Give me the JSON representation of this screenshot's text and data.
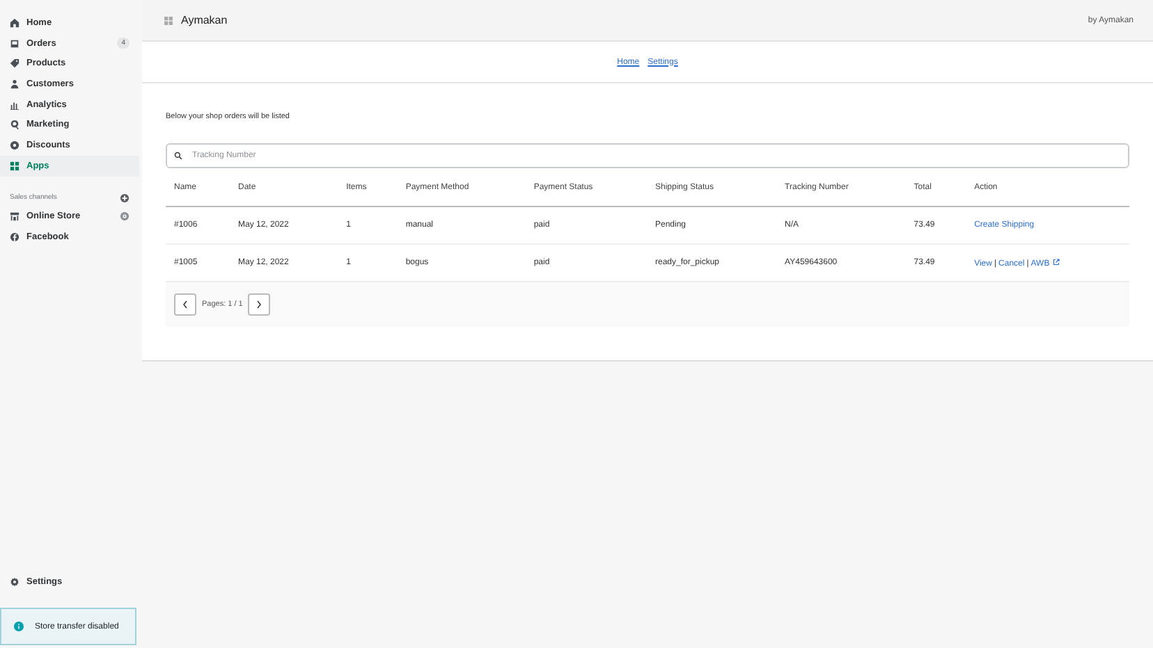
{
  "sidebar": {
    "items": [
      {
        "label": "Home",
        "selected": false
      },
      {
        "label": "Orders",
        "selected": false,
        "badge": "4"
      },
      {
        "label": "Products",
        "selected": false
      },
      {
        "label": "Customers",
        "selected": false
      },
      {
        "label": "Analytics",
        "selected": false
      },
      {
        "label": "Marketing",
        "selected": false
      },
      {
        "label": "Discounts",
        "selected": false
      },
      {
        "label": "Apps",
        "selected": true
      }
    ],
    "channels_heading": "Sales channels",
    "channels": [
      {
        "label": "Online Store",
        "eye": true
      },
      {
        "label": "Facebook",
        "eye": false
      }
    ],
    "settings": "Settings",
    "notice": "Store transfer disabled"
  },
  "header": {
    "title": "Aymakan",
    "byline": "by Aymakan"
  },
  "nav": [
    "Home",
    "Settings"
  ],
  "intro": "Below your shop orders will be listed",
  "search": {
    "placeholder": "Tracking Number"
  },
  "table": {
    "columns": [
      "Name",
      "Date",
      "Items",
      "Payment Method",
      "Payment Status",
      "Shipping Status",
      "Tracking Number",
      "Total",
      "Action"
    ],
    "rows": [
      {
        "cells": [
          "#1006",
          "May 12, 2022",
          "1",
          "manual",
          "paid",
          "Pending",
          "N/A",
          "73.49"
        ],
        "actions": [
          {
            "label": "Create Shipping",
            "external": false
          }
        ]
      },
      {
        "cells": [
          "#1005",
          "May 12, 2022",
          "1",
          "bogus",
          "paid",
          "ready_for_pickup",
          "AY459643600",
          "73.49"
        ],
        "separator": "|",
        "actions": [
          {
            "label": "View",
            "external": false
          },
          {
            "label": "Cancel",
            "external": false
          },
          {
            "label": "AWB",
            "external": true
          }
        ]
      }
    ]
  },
  "pagination": {
    "label": "Pages: 1 / 1"
  }
}
